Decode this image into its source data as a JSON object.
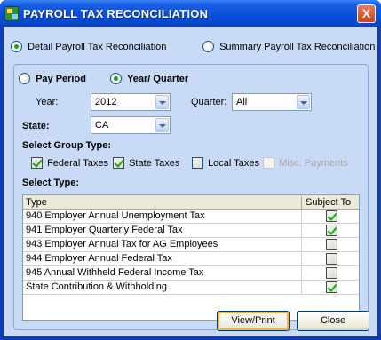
{
  "window": {
    "title": "PAYROLL TAX RECONCILIATION",
    "close_label": "X"
  },
  "report_mode": {
    "detail_label": "Detail Payroll Tax Reconciliation",
    "summary_label": "Summary Payroll Tax Reconciliation",
    "selected": "detail"
  },
  "period": {
    "pay_period_label": "Pay Period",
    "year_quarter_label": "Year/ Quarter",
    "selected": "year_quarter",
    "year_label": "Year:",
    "year_value": "2012",
    "quarter_label": "Quarter:",
    "quarter_value": "All",
    "state_label": "State:",
    "state_value": "CA"
  },
  "group_type": {
    "heading": "Select Group Type:",
    "federal_label": "Federal Taxes",
    "federal_checked": true,
    "state_label": "State Taxes",
    "state_checked": true,
    "local_label": "Local Taxes",
    "local_checked": false,
    "misc_label": "Misc. Payments",
    "misc_enabled": false
  },
  "select_type": {
    "heading": "Select Type:",
    "columns": [
      "Type",
      "Subject To"
    ],
    "rows": [
      {
        "type": "940 Employer Annual Unemployment Tax",
        "subject_to": true
      },
      {
        "type": "941 Employer Quarterly Federal Tax",
        "subject_to": true
      },
      {
        "type": "943 Employer Annual Tax for AG Employees",
        "subject_to": false
      },
      {
        "type": "944 Employer Annual Federal Tax",
        "subject_to": false
      },
      {
        "type": "945 Annual Withheld Federal Income Tax",
        "subject_to": false
      },
      {
        "type": "State Contribution & Withholding",
        "subject_to": true
      }
    ]
  },
  "buttons": {
    "view_print": "View/Print",
    "close": "Close"
  },
  "colors": {
    "titlebar": "#0a4fd9",
    "client_bg": "#c9daf6",
    "check_mark": "#21a121",
    "default_button_ring": "#f5b447"
  }
}
